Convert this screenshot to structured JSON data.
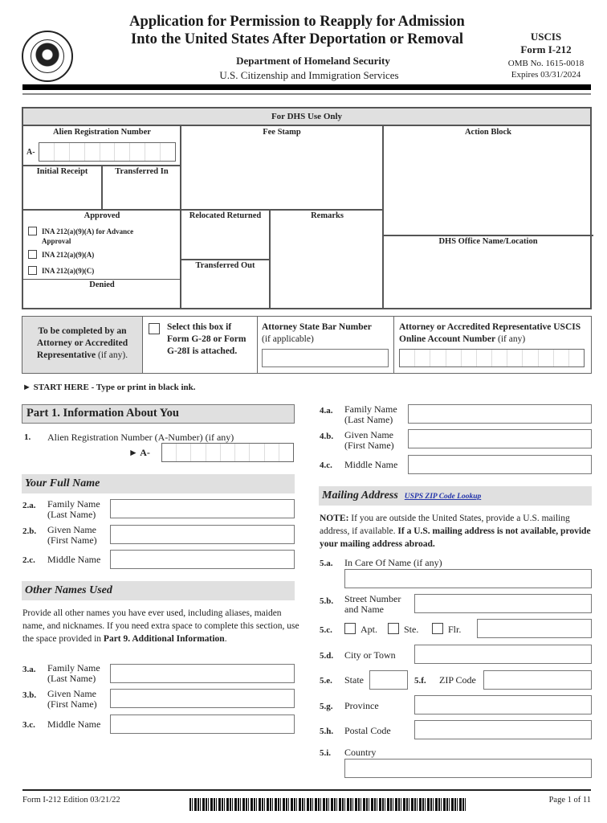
{
  "header": {
    "seal_name": "Department of Homeland Security seal",
    "title_line1": "Application for Permission to Reapply for Admission",
    "title_line2": "Into the United States After Deportation or Removal",
    "department": "Department of Homeland Security",
    "agency": "U.S. Citizenship and Immigration Services",
    "agency_short": "USCIS",
    "form_number": "Form I-212",
    "omb": "OMB No. 1615-0018",
    "expires": "Expires 03/31/2024"
  },
  "dhs_use": {
    "header": "For DHS Use Only",
    "alien_reg_label": "Alien Registration Number",
    "a_prefix": "A-",
    "initial_receipt": "Initial Receipt",
    "transferred_in": "Transferred In",
    "fee_stamp": "Fee Stamp",
    "action_block": "Action Block",
    "approved": "Approved",
    "approved_options": [
      {
        "line1": "INA 212(a)(9)(A) for Advance",
        "line2": "Approval",
        "checked": false
      },
      {
        "line1": "INA 212(a)(9)(A)",
        "line2": "",
        "checked": false
      },
      {
        "line1": "INA 212(a)(9)(C)",
        "line2": "",
        "checked": false
      }
    ],
    "denied": "Denied",
    "relocated_returned": "Relocated Returned",
    "transferred_out": "Transferred Out",
    "remarks": "Remarks",
    "dhs_office": "DHS Office Name/Location"
  },
  "attorney": {
    "col1_bold": "To be completed by an Attorney or Accredited Representative",
    "col1_normal": " (if any).",
    "g28_label": "Select this box if Form G-28 or Form G-28I is attached.",
    "g28_checked": false,
    "bar_label_bold": "Attorney State Bar Number",
    "bar_label_normal": "(if applicable)",
    "bar_value": "",
    "account_label_bold": "Attorney or Accredited Representative USCIS Online Account Number",
    "account_label_normal": " (if any)",
    "account_value": ""
  },
  "start_here": "► START HERE - Type or print in black ink.",
  "part1": {
    "title": "Part 1.  Information About You",
    "q1_num": "1.",
    "q1_label": "Alien Registration Number (A-Number) (if any)",
    "q1_prefix": "►  A-",
    "q1_value": "",
    "full_name_header": "Your Full Name",
    "full_name": [
      {
        "num": "2.a.",
        "label1": "Family Name",
        "label2": "(Last Name)",
        "value": ""
      },
      {
        "num": "2.b.",
        "label1": "Given Name",
        "label2": "(First Name)",
        "value": ""
      },
      {
        "num": "2.c.",
        "label1": "Middle Name",
        "label2": "",
        "value": ""
      }
    ],
    "other_names_header": "Other Names Used",
    "other_names_intro": "Provide all other names you have ever used, including aliases, maiden name, and nicknames. If you need extra space to complete this section, use the space provided in ",
    "other_names_ref": "Part 9. Additional Information",
    "other_names_end": ".",
    "other_names_3": [
      {
        "num": "3.a.",
        "label1": "Family Name",
        "label2": "(Last Name)",
        "value": ""
      },
      {
        "num": "3.b.",
        "label1": "Given Name",
        "label2": "(First Name)",
        "value": ""
      },
      {
        "num": "3.c.",
        "label1": "Middle Name",
        "label2": "",
        "value": ""
      }
    ],
    "other_names_4": [
      {
        "num": "4.a.",
        "label1": "Family Name",
        "label2": "(Last Name)",
        "value": ""
      },
      {
        "num": "4.b.",
        "label1": "Given Name",
        "label2": "(First Name)",
        "value": ""
      },
      {
        "num": "4.c.",
        "label1": "Middle Name",
        "label2": "",
        "value": ""
      }
    ],
    "mailing_header": "Mailing Address",
    "zip_lookup_link": "USPS ZIP Code Lookup",
    "note_bold": "NOTE:",
    "note_normal": "  If you are outside the United States, provide a U.S. mailing address, if available.  ",
    "note_bold2": "If a U.S. mailing address is not available, provide your mailing address abroad.",
    "q5a_num": "5.a.",
    "q5a_label": "In Care Of Name (if any)",
    "q5a_value": "",
    "q5b_num": "5.b.",
    "q5b_label1": "Street Number",
    "q5b_label2": "and Name",
    "q5b_value": "",
    "q5c_num": "5.c.",
    "q5c_apt": "Apt.",
    "q5c_ste": "Ste.",
    "q5c_flr": "Flr.",
    "q5c_value": "",
    "q5d_num": "5.d.",
    "q5d_label": "City or Town",
    "q5d_value": "",
    "q5e_num": "5.e.",
    "q5e_label": "State",
    "q5e_value": "",
    "q5f_num": "5.f.",
    "q5f_label": "ZIP Code",
    "q5f_value": "",
    "q5g_num": "5.g.",
    "q5g_label": "Province",
    "q5g_value": "",
    "q5h_num": "5.h.",
    "q5h_label": "Postal Code",
    "q5h_value": "",
    "q5i_num": "5.i.",
    "q5i_label": "Country",
    "q5i_value": ""
  },
  "footer": {
    "edition": "Form I-212   Edition   03/21/22",
    "page": "Page 1 of 11"
  }
}
